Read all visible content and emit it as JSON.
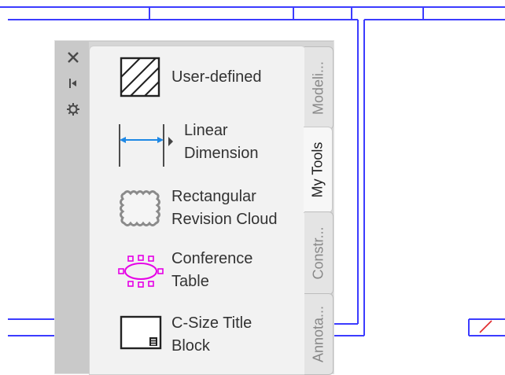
{
  "colors": {
    "cad_line": "#3c3cff",
    "palette_bg": "#d6d6d6",
    "accent_dimension": "#1e88e5",
    "accent_table": "#e600e6"
  },
  "palette": {
    "titlebar_icons": [
      "close-icon",
      "auto-hide-icon",
      "properties-icon"
    ],
    "tools": [
      {
        "label": "User-defined",
        "icon": "hatch-icon"
      },
      {
        "label": "Linear\nDimension",
        "icon": "linear-dimension-icon"
      },
      {
        "label": "Rectangular\nRevision Cloud",
        "icon": "revision-cloud-icon"
      },
      {
        "label": "Conference\nTable",
        "icon": "conference-table-icon"
      },
      {
        "label": "C-Size Title\nBlock",
        "icon": "title-block-icon"
      }
    ],
    "tabs": [
      {
        "label": "Modeli...",
        "active": false
      },
      {
        "label": "My Tools",
        "active": true
      },
      {
        "label": "Constr...",
        "active": false
      },
      {
        "label": "Annota...",
        "active": false
      }
    ]
  }
}
